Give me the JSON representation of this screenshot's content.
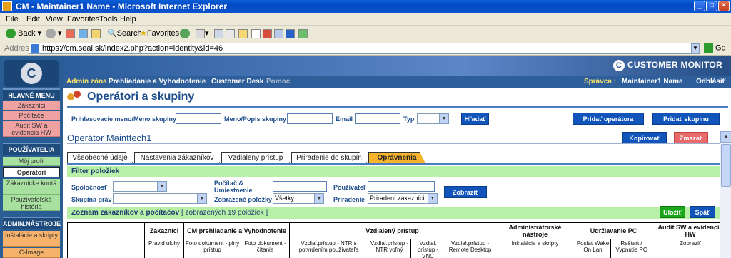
{
  "window": {
    "title": "CM - Maintainer1 Name - Microsoft Internet Explorer"
  },
  "menu": [
    "File",
    "Edit",
    "View",
    "Favorites",
    "Tools",
    "Help"
  ],
  "toolbar": {
    "back": "Back",
    "search": "Search",
    "favorites": "Favorites"
  },
  "address": {
    "label": "Address",
    "url": "https://cm.seal.sk/index2.php?action=identity&id=46",
    "go": "Go"
  },
  "brand": {
    "logo": "C",
    "name": "CUSTOMER MONITOR",
    "icon": "C"
  },
  "nav": {
    "items": [
      "Admin zóna",
      "Prehliadanie a Vyhodnotenie",
      "Customer Desk",
      "Pomoc"
    ],
    "admin_label": "Správca :",
    "admin_name": "Maintainer1 Name",
    "logout": "Odhlásiť"
  },
  "sidebar": {
    "sections": [
      {
        "title": "HLAVNÉ MENU",
        "items": [
          "Zákazníci",
          "Počítače",
          "Audit SW a evidencia HW"
        ]
      },
      {
        "title": "POUŽÍVATELIA",
        "items": [
          "Môj profil",
          "Operátori",
          "Zákaznícke kontá",
          "Používateľská história"
        ]
      },
      {
        "title": "ADMIN.NÁSTROJE",
        "items": [
          "Inštalácie a skripty",
          "C-Image"
        ]
      }
    ]
  },
  "page": {
    "title": "Operátori a skupiny"
  },
  "search": {
    "login_label": "Prihlasovacie meno/Meno skupiny",
    "name_label": "Meno/Popis skupiny",
    "email_label": "Email",
    "type_label": "Typ",
    "find": "Hľadať",
    "add_operator": "Pridať operátora",
    "add_group": "Pridať skupinu"
  },
  "operator": {
    "title": "Operátor Mainttech1",
    "copy": "Kopírovať",
    "delete": "Zmazať"
  },
  "tabs": [
    "Všeobecné údaje",
    "Nastavenia zákazníkov",
    "Vzdialený prístup",
    "Priradenie do skupín",
    "Oprávnenia"
  ],
  "filter": {
    "title": "Filter položiek",
    "company": "Spoločnosť",
    "rights_group": "Skupina práv",
    "computer": "Počítač & Umiestnenie",
    "shown_items": "Zobrazené položky",
    "shown_value": "Všetky",
    "user": "Používateľ",
    "assignment": "Priradenie",
    "assignment_value": "Priradení zákazníci",
    "show": "Zobraziť"
  },
  "list": {
    "title": "Zoznam zákazníkov a počítačov",
    "count": "[ zobrazených 19 položiek ]",
    "save": "Uložiť",
    "back": "Späť"
  },
  "grid": {
    "groups": [
      "Zákazníci",
      "CM prehliadanie a Vyhodnotenie",
      "Vzdialený prístup",
      "Administrátorské nástroje",
      "Udržiavanie PC",
      "Audit SW a evidencia HW"
    ],
    "cols": [
      "Pravid úlohy",
      "Foto dokument - plný prístup",
      "Foto dokument - čítanie",
      "Vzdial.prístup - NTR s potvrdením používateľa",
      "Vzdial.prístup - NTR voľný",
      "Vzdial. prístup - VNC",
      "Vzdial.prístup - Remote Desktop",
      "Inštalácie a skripty",
      "Poslať Wake On Lan",
      "Reštart / Vypnutie PC",
      "Zobraziť"
    ]
  }
}
